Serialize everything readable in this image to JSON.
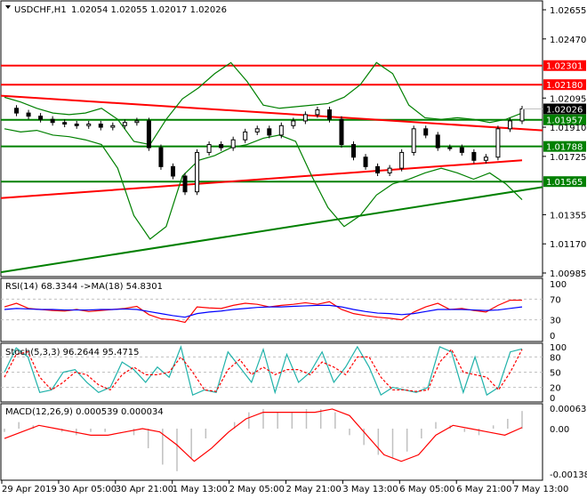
{
  "header": {
    "symbol": "USDCHF,H1",
    "ohlc": "1.02054 1.02055 1.02017 1.02026"
  },
  "colors": {
    "bull": "#000000",
    "red_line": "#ff0000",
    "green_line": "#008000",
    "rsi": "#ff0000",
    "rsi_ma": "#0000ff",
    "stoch_main": "#20b2aa",
    "stoch_signal": "#ff0000",
    "macd_hist": "#c0c0c0",
    "macd_signal": "#ff0000"
  },
  "chart_data": [
    {
      "type": "line",
      "title": "USDCHF,H1",
      "ylim": [
        1.00985,
        1.02655
      ],
      "y_ticks": [
        "1.02655",
        "1.02470",
        "1.02095",
        "1.01910",
        "1.01725",
        "1.01355",
        "1.01170",
        "1.00985"
      ],
      "x_ticks": [
        "29 Apr 2019",
        "30 Apr 05:00",
        "30 Apr 21:00",
        "1 May 13:00",
        "2 May 05:00",
        "2 May 21:00",
        "3 May 13:00",
        "6 May 05:00",
        "6 May 21:00",
        "7 May 13:00"
      ],
      "close": [
        1.0203,
        1.02,
        1.0198,
        1.0196,
        1.0194,
        1.0193,
        1.0192,
        1.0193,
        1.0191,
        1.0192,
        1.0194,
        1.0195,
        1.0178,
        1.0166,
        1.016,
        1.015,
        1.0175,
        1.018,
        1.0178,
        1.0183,
        1.0188,
        1.019,
        1.0186,
        1.0192,
        1.0195,
        1.0199,
        1.0202,
        1.0196,
        1.018,
        1.0172,
        1.0166,
        1.0162,
        1.0165,
        1.0175,
        1.019,
        1.0186,
        1.0178,
        1.0178,
        1.0175,
        1.017,
        1.0172,
        1.019,
        1.0195,
        1.02026
      ],
      "bollinger_upper": [
        1.021,
        1.0207,
        1.0203,
        1.02,
        1.0199,
        1.02,
        1.0203,
        1.0196,
        1.0182,
        1.018,
        1.0196,
        1.0209,
        1.0216,
        1.0225,
        1.0232,
        1.022,
        1.0205,
        1.0203,
        1.0204,
        1.0205,
        1.0206,
        1.021,
        1.0218,
        1.0232,
        1.0225,
        1.0205,
        1.0197,
        1.0196,
        1.0197,
        1.0196,
        1.0194,
        1.0196,
        1.02
      ],
      "bollinger_lower": [
        1.019,
        1.0188,
        1.0189,
        1.0186,
        1.0185,
        1.0183,
        1.018,
        1.0165,
        1.0135,
        1.012,
        1.0128,
        1.016,
        1.017,
        1.0173,
        1.0178,
        1.018,
        1.0184,
        1.0186,
        1.0182,
        1.016,
        1.014,
        1.0128,
        1.0135,
        1.0148,
        1.0155,
        1.0158,
        1.0162,
        1.0165,
        1.0162,
        1.0158,
        1.0162,
        1.0155,
        1.0145
      ],
      "levels": [
        {
          "label": "1.02301",
          "value": 1.02301,
          "color": "red"
        },
        {
          "label": "1.02180",
          "value": 1.0218,
          "color": "red"
        },
        {
          "label": "1.01957",
          "value": 1.01957,
          "color": "green"
        },
        {
          "label": "1.01788",
          "value": 1.01788,
          "color": "green"
        },
        {
          "label": "1.01565",
          "value": 1.01565,
          "color": "green"
        }
      ],
      "current_price_label": "1.02026",
      "trendline_red": [
        1.0211,
        1.0189
      ],
      "trendline_green": [
        1.0099,
        1.0153
      ],
      "ma_red": [
        1.0146,
        1.017
      ]
    },
    {
      "type": "line",
      "title": "RSI(14) 68.3344  ->MA(18) 54.8301",
      "ylim": [
        0,
        100
      ],
      "y_ticks": [
        "100",
        "70",
        "30",
        "0"
      ],
      "rsi": [
        55,
        62,
        52,
        50,
        48,
        47,
        50,
        46,
        48,
        50,
        52,
        56,
        40,
        32,
        30,
        25,
        55,
        53,
        52,
        58,
        62,
        60,
        55,
        58,
        60,
        63,
        60,
        65,
        50,
        42,
        38,
        35,
        33,
        30,
        45,
        55,
        62,
        50,
        52,
        48,
        45,
        58,
        68,
        68
      ],
      "rsi_ma": [
        50,
        52,
        51,
        50,
        50,
        49,
        49,
        49,
        50,
        50,
        51,
        50,
        46,
        42,
        38,
        35,
        42,
        45,
        47,
        50,
        52,
        54,
        55,
        55,
        56,
        57,
        58,
        58,
        55,
        50,
        46,
        43,
        42,
        40,
        42,
        46,
        50,
        50,
        50,
        49,
        48,
        49,
        52,
        55
      ]
    },
    {
      "type": "line",
      "title": "Stoch(5,3,3) 96.2644 95.4715",
      "ylim": [
        0,
        100
      ],
      "y_ticks": [
        "100",
        "80",
        "50",
        "20",
        "0"
      ],
      "main": [
        50,
        98,
        80,
        10,
        15,
        50,
        55,
        30,
        10,
        20,
        70,
        55,
        30,
        60,
        40,
        100,
        5,
        15,
        10,
        90,
        60,
        30,
        95,
        10,
        85,
        30,
        50,
        90,
        30,
        60,
        100,
        60,
        5,
        20,
        15,
        10,
        20,
        100,
        90,
        10,
        80,
        5,
        20,
        90,
        96
      ],
      "signal": [
        40,
        85,
        90,
        40,
        15,
        30,
        50,
        45,
        25,
        15,
        45,
        60,
        45,
        45,
        50,
        80,
        50,
        15,
        12,
        55,
        75,
        45,
        60,
        45,
        55,
        55,
        45,
        70,
        60,
        45,
        80,
        80,
        40,
        15,
        15,
        12,
        15,
        70,
        95,
        50,
        45,
        40,
        15,
        50,
        95
      ]
    },
    {
      "type": "bar",
      "title": "MACD(12,26,9) 0.000539 0.000034",
      "ylim": [
        -0.001387,
        0.000631
      ],
      "y_ticks": [
        "0.000631",
        "0.00",
        "-0.001387"
      ],
      "histogram": [
        -0.0001,
        0.0002,
        0.0001,
        0.0,
        -0.0001,
        -0.0002,
        -0.0001,
        -0.0001,
        0.0,
        -0.0002,
        -0.0006,
        -0.0011,
        -0.0013,
        -0.0009,
        -0.0003,
        0.0,
        0.0002,
        0.0005,
        0.0006,
        0.0005,
        0.0005,
        0.0006,
        0.0006,
        0.0005,
        -0.0002,
        -0.0005,
        -0.0008,
        -0.0009,
        -0.0007,
        -0.0003,
        0.0002,
        0.0001,
        -0.0001,
        -0.0002,
        0.0001,
        0.0003,
        0.000539
      ],
      "signal": [
        -0.0003,
        -0.0001,
        0.0001,
        0.0,
        -0.0001,
        -0.0002,
        -0.0002,
        -0.0001,
        0.0,
        -0.0001,
        -0.0005,
        -0.001,
        -0.0006,
        -0.0001,
        0.0003,
        0.0005,
        0.0005,
        0.0005,
        0.0005,
        0.0006,
        0.0004,
        -0.0002,
        -0.0008,
        -0.001,
        -0.0008,
        -0.0002,
        0.0001,
        0.0,
        -0.0001,
        -0.0002,
        3.4e-05
      ]
    }
  ]
}
